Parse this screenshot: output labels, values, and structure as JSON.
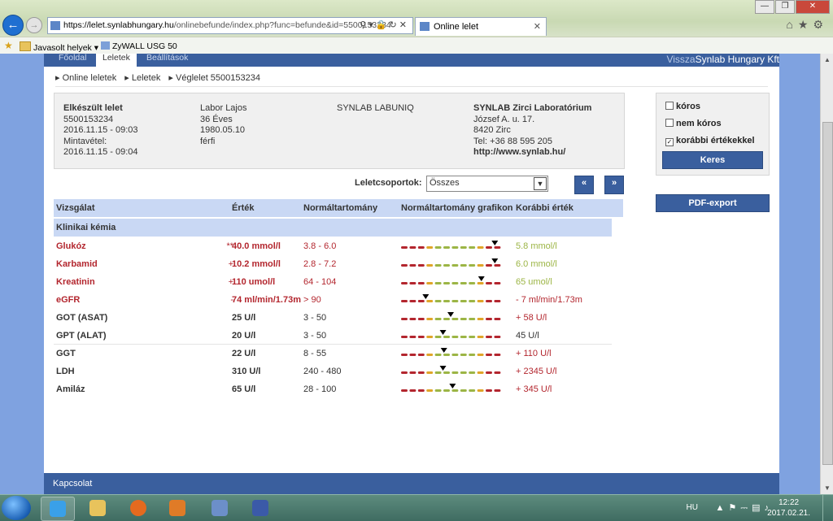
{
  "browser": {
    "url_domain": "https://lelet.synlabhungary.hu",
    "url_rest": "/onlinebefunde/index.php?func=befunde&id=5500153234",
    "tab_title": "Online lelet",
    "favorites": [
      {
        "label": "Javasolt helyek ▾"
      },
      {
        "label": "ZyWALL USG 50"
      }
    ]
  },
  "nav": {
    "tabs": [
      "Főoldal",
      "Leletek",
      "Beállítások"
    ],
    "right_prefix": "Vissza",
    "right_company": "Synlab Hungary Kft"
  },
  "breadcrumb": [
    "▸ Online leletek",
    "▸ Leletek",
    "▸ Véglelet 5500153234"
  ],
  "info": {
    "col1": [
      "Elkészült lelet",
      "5500153234",
      "2016.11.15 - 09:03",
      "Mintavétel:",
      "2016.11.15 - 09:04"
    ],
    "col2": [
      "Labor Lajos",
      "36 Éves",
      "1980.05.10",
      "férfi"
    ],
    "col3": [
      "SYNLAB LABUNIQ"
    ],
    "col4": [
      "SYNLAB Zirci Laboratórium",
      "József A. u. 17.",
      "8420 Zirc",
      "Tel: +36 88 595 205",
      "http://www.synlab.hu/"
    ]
  },
  "filters": {
    "koros": {
      "label": "kóros",
      "checked": false
    },
    "nem_koros": {
      "label": "nem kóros",
      "checked": false
    },
    "korabbi": {
      "label": "korábbi értékekkel",
      "checked": true,
      "mark": "✓"
    },
    "search_button": "Keres",
    "pdf_button": "PDF-export"
  },
  "group_select": {
    "label": "Leletcsoportok:",
    "value": "Összes",
    "arrow": "▼"
  },
  "pager": {
    "prev": "«",
    "next": "»"
  },
  "table": {
    "headers": [
      "Vizsgálat",
      "Érték",
      "Normáltartomány",
      "Normáltartomány grafikon",
      "Korábbi érték"
    ],
    "group": "Klinikai kémia",
    "rows": [
      {
        "name": "Glukóz",
        "flag": "**",
        "value": "40.0 mmol/l",
        "range": "3.8 - 6.0",
        "prev": "5.8 mmol/l",
        "status": "bad",
        "prev_status": "ok",
        "marker": 0.96
      },
      {
        "name": "Karbamid",
        "flag": "+",
        "value": "10.2 mmol/l",
        "range": "2.8 - 7.2",
        "prev": "6.0 mmol/l",
        "status": "bad",
        "prev_status": "ok",
        "marker": 0.96
      },
      {
        "name": "Kreatinin",
        "flag": "+",
        "value": "110 umol/l",
        "range": "64 - 104",
        "prev": "65 umol/l",
        "status": "bad",
        "prev_status": "ok",
        "marker": 0.82
      },
      {
        "name": "eGFR",
        "flag": "-",
        "value": "74 ml/min/1.73m",
        "range": "> 90",
        "prev": "- 7 ml/min/1.73m",
        "status": "bad",
        "prev_status": "bad",
        "marker": 0.24
      },
      {
        "name": "GOT (ASAT)",
        "flag": "",
        "value": "25 U/l",
        "range": "3 - 50",
        "prev": "+ 58 U/l",
        "status": "ok",
        "prev_status": "bad",
        "marker": 0.5
      },
      {
        "name": "GPT (ALAT)",
        "flag": "",
        "value": "20 U/l",
        "range": "3 - 50",
        "prev": "45 U/l",
        "status": "ok",
        "prev_status": "neutral",
        "marker": 0.42
      },
      {
        "name": "GGT",
        "flag": "",
        "value": "22 U/l",
        "range": "8 - 55",
        "prev": "+ 110 U/l",
        "status": "ok",
        "prev_status": "bad",
        "marker": 0.43
      },
      {
        "name": "LDH",
        "flag": "",
        "value": "310 U/l",
        "range": "240 - 480",
        "prev": "+ 2345 U/l",
        "status": "ok",
        "prev_status": "bad",
        "marker": 0.42
      },
      {
        "name": "Amiláz",
        "flag": "",
        "value": "65 U/l",
        "range": "28 - 100",
        "prev": "+ 345 U/l",
        "status": "ok",
        "prev_status": "bad",
        "marker": 0.52
      }
    ]
  },
  "footer": {
    "label": "Kapcsolat"
  },
  "colors": {
    "bad": "#b3262e",
    "warn": "#e0a528",
    "good": "#9cb545",
    "brand": "#3a5f9e"
  },
  "taskbar": {
    "lang": "HU",
    "time": "12:22",
    "date": "2017.02.21."
  }
}
